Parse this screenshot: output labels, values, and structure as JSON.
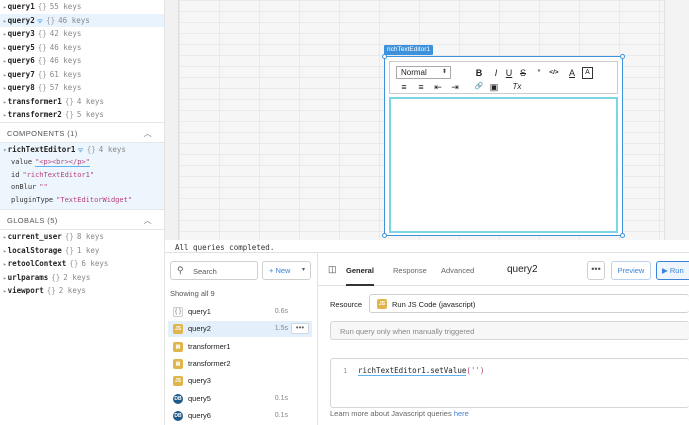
{
  "state": {
    "queries": [
      {
        "name": "query1",
        "braces": "{}",
        "count": "55 keys"
      },
      {
        "name": "query2",
        "braces": "{}",
        "count": "46 keys",
        "selected": true
      },
      {
        "name": "query3",
        "braces": "{}",
        "count": "42 keys"
      },
      {
        "name": "query5",
        "braces": "{}",
        "count": "46 keys"
      },
      {
        "name": "query6",
        "braces": "{}",
        "count": "46 keys"
      },
      {
        "name": "query7",
        "braces": "{}",
        "count": "61 keys"
      },
      {
        "name": "query8",
        "braces": "{}",
        "count": "57 keys"
      },
      {
        "name": "transformer1",
        "braces": "{}",
        "count": "4 keys"
      },
      {
        "name": "transformer2",
        "braces": "{}",
        "count": "5 keys"
      }
    ],
    "components_header": "COMPONENTS (1)",
    "component": {
      "name": "richTextEditor1",
      "braces": "{}",
      "count": "4 keys",
      "props": [
        {
          "key": "value",
          "val": "\"<p><br></p>\""
        },
        {
          "key": "id",
          "val": "\"richTextEditor1\""
        },
        {
          "key": "onBlur",
          "val": "\"\""
        },
        {
          "key": "pluginType",
          "val": "\"TextEditorWidget\""
        }
      ]
    },
    "globals_header": "GLOBALS (5)",
    "globals": [
      {
        "name": "current_user",
        "braces": "{}",
        "count": "8 keys"
      },
      {
        "name": "localStorage",
        "braces": "{}",
        "count": "1 key"
      },
      {
        "name": "retoolContext",
        "braces": "{}",
        "count": "6 keys"
      },
      {
        "name": "urlparams",
        "braces": "{}",
        "count": "2 keys"
      },
      {
        "name": "viewport",
        "braces": "{}",
        "count": "2 keys"
      }
    ]
  },
  "canvas": {
    "widget_tag": "richTextEditor1",
    "format_select": "Normal",
    "toolbar_row1": [
      "B",
      "I",
      "U",
      "S",
      "”",
      "</>",
      "A",
      "A"
    ],
    "toolbar_row2": [
      "≡",
      "≡",
      "⇤",
      "⇥",
      "🔗",
      "▣",
      "Tx"
    ],
    "console_message": "All queries completed."
  },
  "queries_panel": {
    "search_placeholder": "Search",
    "new_label": "+ New",
    "showing": "Showing all 9",
    "items": [
      {
        "name": "query1",
        "time": "0.6s",
        "icon": "empty",
        "glyph": "{ }"
      },
      {
        "name": "query2",
        "time": "1.5s",
        "icon": "js",
        "glyph": "JS",
        "selected": true
      },
      {
        "name": "transformer1",
        "time": "",
        "icon": "tr",
        "glyph": "▤"
      },
      {
        "name": "transformer2",
        "time": "",
        "icon": "tr",
        "glyph": "▤"
      },
      {
        "name": "query3",
        "time": "",
        "icon": "js",
        "glyph": "JS"
      },
      {
        "name": "query5",
        "time": "0.1s",
        "icon": "db",
        "glyph": "DB"
      },
      {
        "name": "query6",
        "time": "0.1s",
        "icon": "db",
        "glyph": "DB"
      }
    ]
  },
  "editor": {
    "tabs": [
      "General",
      "Response",
      "Advanced"
    ],
    "active_tab": "General",
    "query_name": "query2",
    "dots": "•••",
    "preview_label": "Preview",
    "run_label": "▶ Run",
    "resource_label": "Resource",
    "resource_value": "Run JS Code (javascript)",
    "trigger_text": "Run query only when manually triggered",
    "line_number": "1",
    "code_fn": "richTextEditor1.setValue",
    "code_arg": "('')",
    "learn_text": "Learn more about Javascript queries ",
    "learn_link": "here"
  },
  "colors": {
    "accent": "#3c92dc",
    "editor_border": "#7dd4e4",
    "string": "#b5417d"
  }
}
